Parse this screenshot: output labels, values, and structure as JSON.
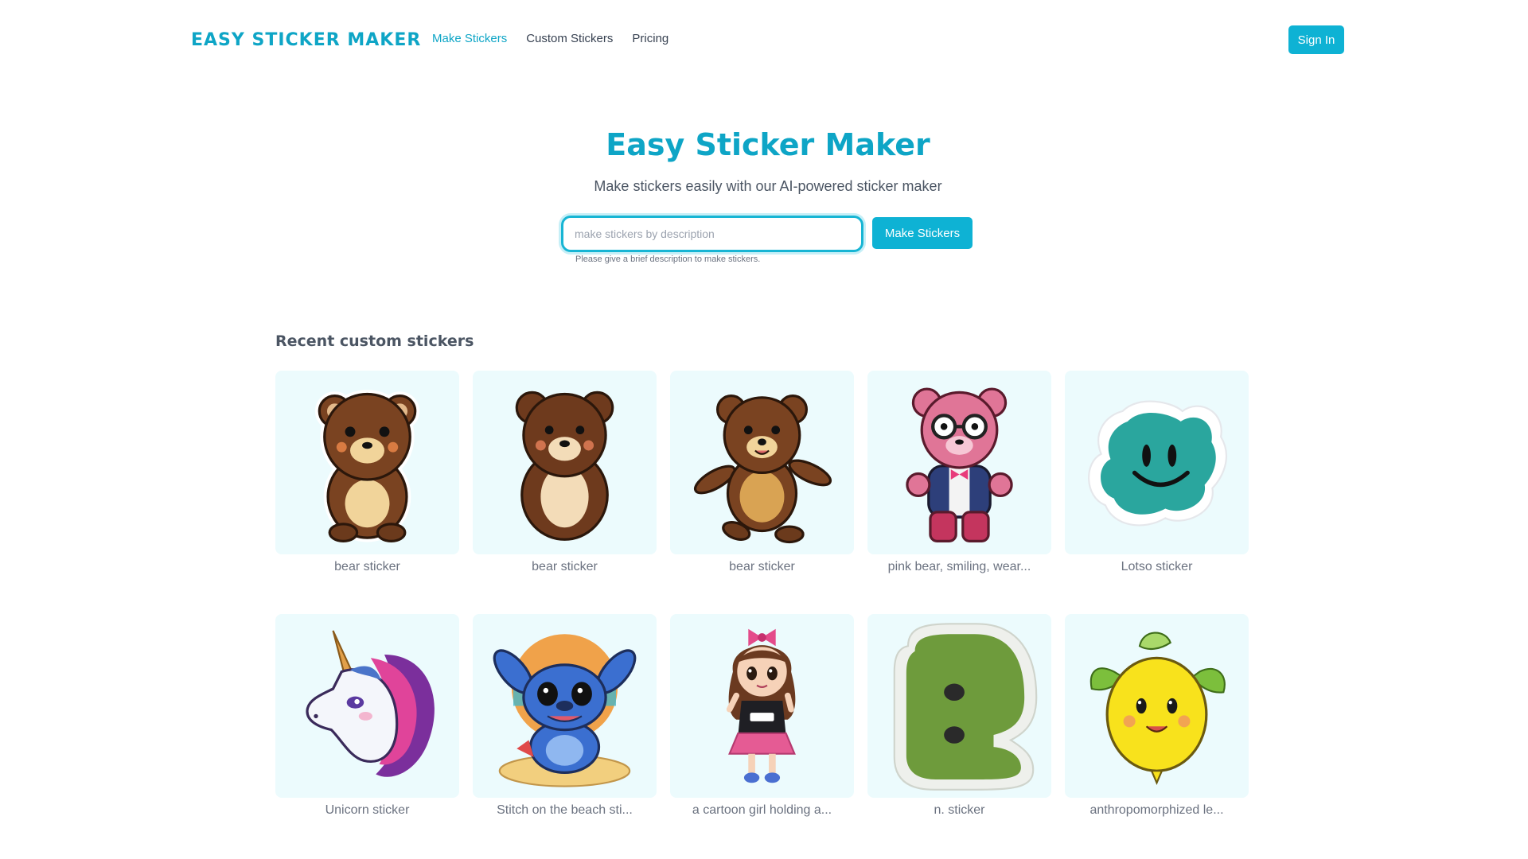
{
  "header": {
    "logo_text": "EASY STICKER MAKER",
    "nav": [
      {
        "label": "Make Stickers",
        "active": true
      },
      {
        "label": "Custom Stickers",
        "active": false
      },
      {
        "label": "Pricing",
        "active": false
      }
    ],
    "signin_label": "Sign In"
  },
  "hero": {
    "title": "Easy Sticker Maker",
    "subtitle": "Make stickers easily with our AI-powered sticker maker",
    "search_placeholder": "make stickers by description",
    "search_value": "",
    "button_label": "Make Stickers",
    "hint": "Please give a brief description to make stickers."
  },
  "recent": {
    "title": "Recent custom stickers",
    "items": [
      {
        "caption": "bear sticker",
        "icon": "brown-bear-sticker"
      },
      {
        "caption": "bear sticker",
        "icon": "brown-bear-sticker"
      },
      {
        "caption": "bear sticker",
        "icon": "dancing-bear-sticker"
      },
      {
        "caption": "pink bear, smiling, wear...",
        "icon": "pink-bear-glasses-sticker"
      },
      {
        "caption": "Lotso sticker",
        "icon": "teal-blob-smile-sticker"
      },
      {
        "caption": "Unicorn sticker",
        "icon": "unicorn-head-sticker"
      },
      {
        "caption": "Stitch on the beach sti...",
        "icon": "stitch-beach-sticker"
      },
      {
        "caption": "a cartoon girl holding a...",
        "icon": "cartoon-girl-sticker"
      },
      {
        "caption": "n. sticker",
        "icon": "green-letter-sticker"
      },
      {
        "caption": "anthropomorphized le...",
        "icon": "lemon-face-sticker"
      }
    ]
  },
  "colors": {
    "accent": "#0eb2d4",
    "title": "#0ea5c6",
    "card_bg": "#ecfbfd"
  }
}
